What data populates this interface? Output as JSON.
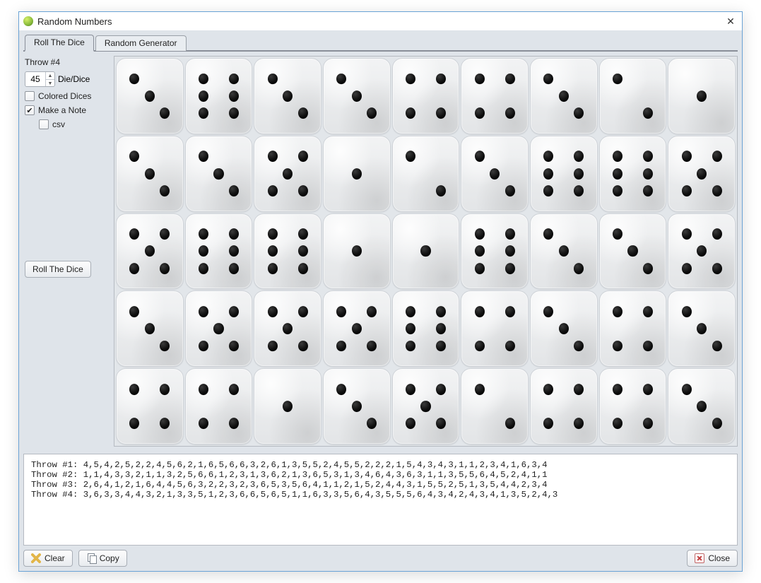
{
  "window": {
    "title": "Random Numbers"
  },
  "tabs": {
    "roll": "Roll The Dice",
    "gen": "Random Generator",
    "active": 0
  },
  "sidebar": {
    "throw_label": "Throw #4",
    "dice_count": "45",
    "dice_label": "Die/Dice",
    "colored_label": "Colored Dices",
    "colored_checked": false,
    "note_label": "Make a Note",
    "note_checked": true,
    "csv_label": "csv",
    "csv_checked": false,
    "roll_button": "Roll The Dice"
  },
  "dice": [
    3,
    6,
    3,
    3,
    4,
    4,
    3,
    2,
    1,
    3,
    3,
    5,
    1,
    2,
    3,
    6,
    6,
    5,
    5,
    6,
    6,
    1,
    1,
    6,
    3,
    3,
    5,
    3,
    5,
    5,
    5,
    6,
    4,
    3,
    4,
    3,
    4,
    4,
    1,
    3,
    5,
    2,
    4,
    4,
    3
  ],
  "notes": [
    "Throw #1: 4,5,4,2,5,2,2,4,5,6,2,1,6,5,6,6,3,2,6,1,3,5,5,2,4,5,5,2,2,2,1,5,4,3,4,3,1,1,2,3,4,1,6,3,4",
    "Throw #2: 1,1,4,3,3,2,1,1,3,2,5,6,6,1,2,3,1,3,6,2,1,3,6,5,3,1,3,4,6,4,3,6,3,1,1,3,5,5,6,4,5,2,4,1,1",
    "Throw #3: 2,6,4,1,2,1,6,4,4,5,6,3,2,2,3,2,3,6,5,3,5,6,4,1,1,2,1,5,2,4,4,3,1,5,5,2,5,1,3,5,4,4,2,3,4",
    "Throw #4: 3,6,3,3,4,4,3,2,1,3,3,5,1,2,3,6,6,5,6,5,1,1,6,3,3,5,6,4,3,5,5,5,6,4,3,4,2,4,3,4,1,3,5,2,4,3"
  ],
  "footer": {
    "clear": "Clear",
    "copy": "Copy",
    "close": "Close"
  }
}
